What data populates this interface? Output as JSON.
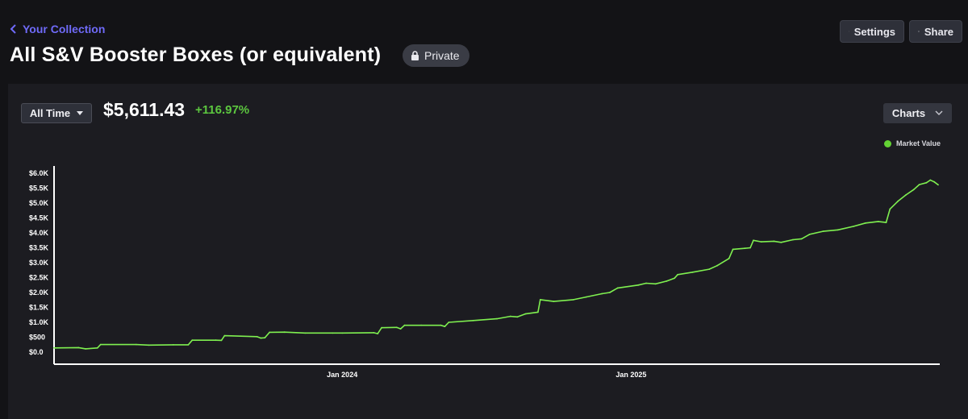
{
  "header": {
    "back_label": "Your Collection",
    "title": "All S&V Booster Boxes (or equivalent)",
    "privacy_badge": "Private",
    "settings_label": "Settings",
    "share_label": "Share",
    "icons": {
      "back": "chevron-left-icon",
      "lock": "lock-icon",
      "settings": "gear-icon",
      "share": "link-icon"
    }
  },
  "summary": {
    "range_label": "All Time",
    "value": "$5,611.43",
    "change": "+116.97%",
    "charts_label": "Charts"
  },
  "colors": {
    "accent": "#6f6af8",
    "positive": "#5cc63f",
    "line": "#7ff050",
    "background": "#131316",
    "panel": "#1c1c21"
  },
  "chart_data": {
    "type": "line",
    "series": [
      {
        "name": "Market Value",
        "points": [
          [
            "2023-01-01",
            140
          ],
          [
            "2023-02-01",
            150
          ],
          [
            "2023-02-10",
            110
          ],
          [
            "2023-02-25",
            140
          ],
          [
            "2023-03-01",
            255
          ],
          [
            "2023-04-15",
            255
          ],
          [
            "2023-05-01",
            235
          ],
          [
            "2023-06-01",
            245
          ],
          [
            "2023-06-20",
            245
          ],
          [
            "2023-06-25",
            400
          ],
          [
            "2023-07-25",
            400
          ],
          [
            "2023-08-01",
            395
          ],
          [
            "2023-08-05",
            550
          ],
          [
            "2023-09-15",
            520
          ],
          [
            "2023-09-20",
            470
          ],
          [
            "2023-09-25",
            480
          ],
          [
            "2023-10-01",
            665
          ],
          [
            "2023-10-20",
            670
          ],
          [
            "2023-11-15",
            640
          ],
          [
            "2023-12-20",
            640
          ],
          [
            "2024-01-01",
            640
          ],
          [
            "2024-02-10",
            650
          ],
          [
            "2024-02-15",
            620
          ],
          [
            "2024-02-20",
            820
          ],
          [
            "2024-03-10",
            830
          ],
          [
            "2024-03-15",
            780
          ],
          [
            "2024-03-20",
            900
          ],
          [
            "2024-04-10",
            900
          ],
          [
            "2024-05-05",
            900
          ],
          [
            "2024-05-10",
            860
          ],
          [
            "2024-05-15",
            1000
          ],
          [
            "2024-06-15",
            1060
          ],
          [
            "2024-07-15",
            1120
          ],
          [
            "2024-08-01",
            1200
          ],
          [
            "2024-08-10",
            1180
          ],
          [
            "2024-08-20",
            1280
          ],
          [
            "2024-09-05",
            1340
          ],
          [
            "2024-09-08",
            1760
          ],
          [
            "2024-09-25",
            1700
          ],
          [
            "2024-10-20",
            1760
          ],
          [
            "2024-11-05",
            1850
          ],
          [
            "2024-11-25",
            1960
          ],
          [
            "2024-12-05",
            2000
          ],
          [
            "2024-12-15",
            2150
          ],
          [
            "2025-01-10",
            2250
          ],
          [
            "2025-01-20",
            2310
          ],
          [
            "2025-02-01",
            2290
          ],
          [
            "2025-02-15",
            2380
          ],
          [
            "2025-02-25",
            2480
          ],
          [
            "2025-03-01",
            2600
          ],
          [
            "2025-03-20",
            2680
          ],
          [
            "2025-04-10",
            2780
          ],
          [
            "2025-04-20",
            2900
          ],
          [
            "2025-05-05",
            3140
          ],
          [
            "2025-05-10",
            3450
          ],
          [
            "2025-05-25",
            3480
          ],
          [
            "2025-06-01",
            3500
          ],
          [
            "2025-06-05",
            3750
          ],
          [
            "2025-06-15",
            3700
          ],
          [
            "2025-07-01",
            3720
          ],
          [
            "2025-07-10",
            3680
          ],
          [
            "2025-07-25",
            3770
          ],
          [
            "2025-08-05",
            3800
          ],
          [
            "2025-08-15",
            3950
          ],
          [
            "2025-09-01",
            4050
          ],
          [
            "2025-09-20",
            4100
          ],
          [
            "2025-10-10",
            4220
          ],
          [
            "2025-10-25",
            4330
          ],
          [
            "2025-11-10",
            4380
          ],
          [
            "2025-11-20",
            4350
          ],
          [
            "2025-11-25",
            4800
          ],
          [
            "2025-12-05",
            5060
          ],
          [
            "2025-12-15",
            5270
          ],
          [
            "2025-12-25",
            5450
          ],
          [
            "2026-01-01",
            5620
          ],
          [
            "2026-01-10",
            5680
          ],
          [
            "2026-01-15",
            5770
          ],
          [
            "2026-01-20",
            5710
          ],
          [
            "2026-01-25",
            5611
          ]
        ]
      }
    ],
    "y_ticks": [
      {
        "value": 0,
        "label": "$0.0"
      },
      {
        "value": 500,
        "label": "$500"
      },
      {
        "value": 1000,
        "label": "$1.0K"
      },
      {
        "value": 1500,
        "label": "$1.5K"
      },
      {
        "value": 2000,
        "label": "$2.0K"
      },
      {
        "value": 2500,
        "label": "$2.5K"
      },
      {
        "value": 3000,
        "label": "$3.0K"
      },
      {
        "value": 3500,
        "label": "$3.5K"
      },
      {
        "value": 4000,
        "label": "$4.0K"
      },
      {
        "value": 4500,
        "label": "$4.5K"
      },
      {
        "value": 5000,
        "label": "$5.0K"
      },
      {
        "value": 5500,
        "label": "$5.5K"
      },
      {
        "value": 6000,
        "label": "$6.0K"
      }
    ],
    "x_ticks": [
      {
        "value": "2024-01-01",
        "label": "Jan 2024"
      },
      {
        "value": "2025-01-01",
        "label": "Jan 2025"
      }
    ],
    "xlim": [
      "2023-01-01",
      "2026-01-27"
    ],
    "ylim": [
      0,
      6000
    ],
    "grid": false,
    "legend_position": "top-right"
  }
}
